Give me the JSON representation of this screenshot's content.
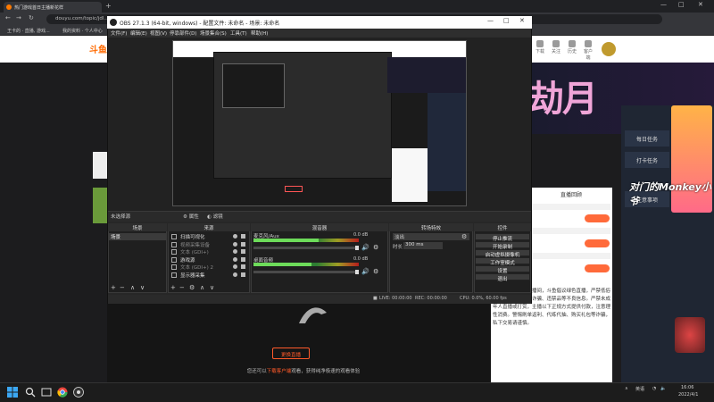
{
  "browser": {
    "tab_title": "热门游戏首日主播新花样",
    "address": "douyu.com/topic/jdl...",
    "bookmarks": [
      "王卡的 · 直播, 游戏...",
      "我的资料 · 个人中心"
    ]
  },
  "site": {
    "logo": "斗鱼",
    "header_icons": [
      "下载",
      "关注",
      "历史",
      "客户端",
      "消息",
      "创作中心"
    ],
    "banner_text": "劫月",
    "side_items": [
      "每日任务",
      "打卡任务",
      "注意事项"
    ],
    "chat_title": "直播回顾",
    "chat_notice": "欢迎来到王卡的直播间，斗鱼倡议绿色直播，严禁低俗色情、赌博、造谣诈骗、违禁品等不良信息。严禁未成年人直播或打赏，主播以下正规方式提供付款，注意理性消费。警惕刷单返利、代练代抽、购买礼包等诈骗，私下交易请谨慎。",
    "offline_button": "更换直播",
    "offline_tip_prefix": "您还可以",
    "offline_tip_link": "下载客户端",
    "offline_tip_suffix": "观看，获得纯净极速的观看体验",
    "watermark": "对门的Monkey小爷"
  },
  "obs": {
    "title": "OBS 27.1.3 (64-bit, windows) - 配置文件: 未命名 - 场景: 未命名",
    "menu": [
      "文件(F)",
      "编辑(E)",
      "视图(V)",
      "停靠部件(D)",
      "场景集合(S)",
      "工具(T)",
      "帮助(H)"
    ],
    "no_source": "未选择源",
    "source_buttons": [
      "属性",
      "滤镜"
    ],
    "docks": {
      "scenes": "场景",
      "sources": "来源",
      "mixer": "混音器",
      "transitions": "转场特效",
      "controls": "控件"
    },
    "scene_items": [
      "场景"
    ],
    "sources": [
      {
        "name": "扫描可视化",
        "dim": false
      },
      {
        "name": "视频采集设备",
        "dim": true
      },
      {
        "name": "文本 (GDI+)",
        "dim": true
      },
      {
        "name": "游戏源",
        "dim": false
      },
      {
        "name": "文本 (GDI+) 2",
        "dim": true
      },
      {
        "name": "显示器采集",
        "dim": false
      }
    ],
    "mixer": [
      {
        "name": "麦克风/Aux",
        "db": "0.0 dB",
        "level": 0.62
      },
      {
        "name": "桌面音频",
        "db": "0.0 dB",
        "level": 0.55
      }
    ],
    "transition": {
      "selected": "淡出",
      "duration_label": "时长",
      "duration": "300 ms"
    },
    "controls": [
      "停止推流",
      "开始录制",
      "启动虚拟摄像机",
      "工作室模式",
      "设置",
      "退出"
    ],
    "status": {
      "live": "LIVE: 00:00:00",
      "rec": "REC: 00:00:00",
      "cpu": "CPU: 0.0%, 60.00 fps"
    }
  },
  "taskbar": {
    "lang": "英语",
    "time": "16:06",
    "date": "2022/4/1"
  }
}
